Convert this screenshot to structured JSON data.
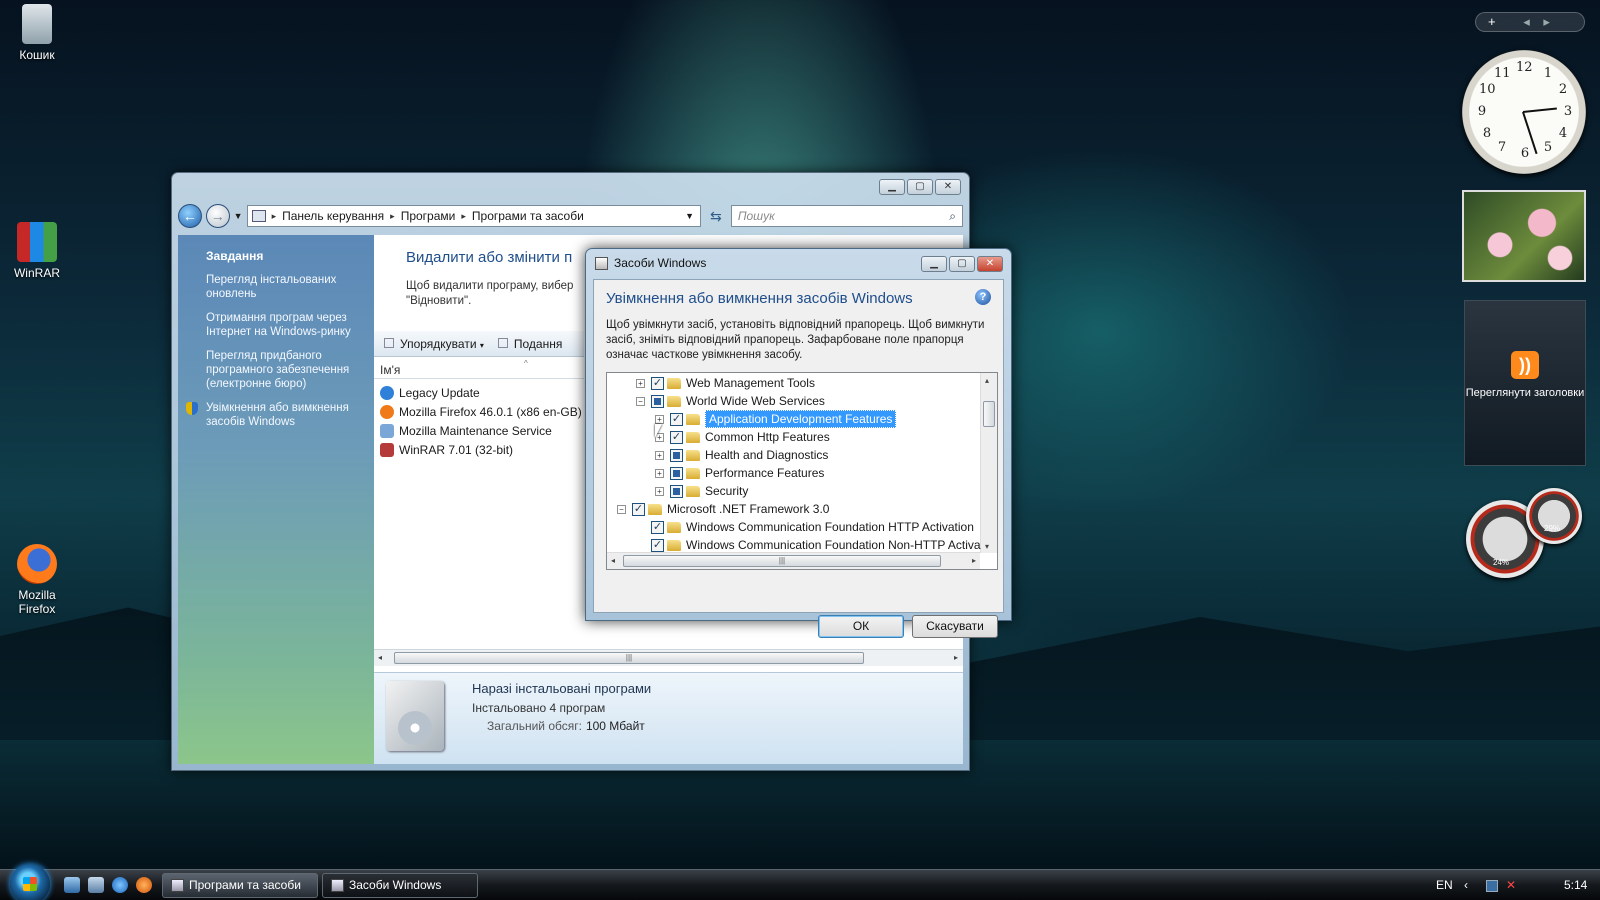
{
  "desktop": {
    "icons": [
      {
        "label": "Кошик",
        "icon": "recycle-bin-icon"
      },
      {
        "label": "WinRAR",
        "icon": "winrar-icon"
      },
      {
        "label": "Mozilla Firefox",
        "icon": "firefox-icon"
      }
    ]
  },
  "gadgets": {
    "bar_add": "+",
    "clock_time": "3:27",
    "feed_label": "Переглянути заголовки",
    "cpu_percent": "24%",
    "memory_percent": "29%"
  },
  "explorer": {
    "breadcrumb": [
      "Панель керування",
      "Програми",
      "Програми та засоби"
    ],
    "search_placeholder": "Пошук",
    "tasks_header": "Завдання",
    "tasks": [
      "Перегляд інстальованих оновлень",
      "Отримання програм через Інтернет на Windows-ринку",
      "Перегляд придбаного програмного забезпечення (електронне бюро)",
      "Увімкнення або вимкнення засобів Windows"
    ],
    "title": "Видалити або змінити п",
    "description": "Щоб видалити програму, вибер \"Відновити\".",
    "toolbar": {
      "organize": "Упорядкувати",
      "views": "Подання"
    },
    "column_name": "Ім'я",
    "programs": [
      {
        "name": "Legacy Update",
        "color": "#2f80d8"
      },
      {
        "name": "Mozilla Firefox 46.0.1 (x86 en-GB)",
        "color": "#f07a1a"
      },
      {
        "name": "Mozilla Maintenance Service",
        "color": "#7aa6d8"
      },
      {
        "name": "WinRAR 7.01 (32-bit)",
        "color": "#b53a3a"
      }
    ],
    "details": {
      "title": "Наразі інстальовані програми",
      "count": "Інстальовано 4 програм",
      "total_label": "Загальний обсяг:",
      "total_value": "100 Мбайт"
    }
  },
  "dialog": {
    "title": "Засоби Windows",
    "heading": "Увімкнення або вимкнення засобів Windows",
    "explanation": "Щоб увімкнути засіб, установіть відповідний прапорець. Щоб вимкнути засіб, зніміть відповідний прапорець. Зафарбоване поле прапорця означає часткове увімкнення засобу.",
    "tree": [
      {
        "label": "Web Management Tools",
        "level": 1,
        "expander": "+",
        "state": "checked",
        "selected": false
      },
      {
        "label": "World Wide Web Services",
        "level": 1,
        "expander": "−",
        "state": "partial",
        "selected": false
      },
      {
        "label": "Application Development Features",
        "level": 2,
        "expander": "+",
        "state": "checked",
        "selected": true
      },
      {
        "label": "Common Http Features",
        "level": 2,
        "expander": "+",
        "state": "checked",
        "selected": false
      },
      {
        "label": "Health and Diagnostics",
        "level": 2,
        "expander": "+",
        "state": "partial",
        "selected": false
      },
      {
        "label": "Performance Features",
        "level": 2,
        "expander": "+",
        "state": "partial",
        "selected": false
      },
      {
        "label": "Security",
        "level": 2,
        "expander": "+",
        "state": "partial",
        "selected": false
      },
      {
        "label": "Microsoft .NET Framework 3.0",
        "level": 0,
        "expander": "−",
        "state": "checked",
        "selected": false
      },
      {
        "label": "Windows Communication Foundation HTTP Activation",
        "level": 1,
        "expander": "",
        "state": "checked",
        "selected": false
      },
      {
        "label": "Windows Communication Foundation Non-HTTP Activa",
        "level": 1,
        "expander": "",
        "state": "checked",
        "selected": false
      }
    ],
    "ok_label": "ОК",
    "cancel_label": "Скасувати"
  },
  "taskbar": {
    "buttons": [
      "Програми та засоби",
      "Засоби Windows"
    ],
    "language": "EN",
    "time": "5:14"
  }
}
